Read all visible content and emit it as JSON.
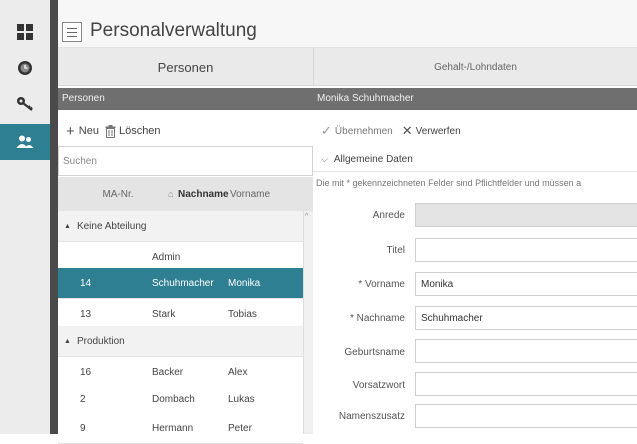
{
  "app": {
    "title": "Personalverwaltung"
  },
  "tabs": [
    {
      "label": "Personen"
    },
    {
      "label": "Gehalt-/Lohndaten"
    }
  ],
  "left_pane": {
    "header": "Personen",
    "toolbar": {
      "new_label": "Neu",
      "delete_label": "Löschen"
    },
    "search": {
      "placeholder": "Suchen"
    },
    "columns": [
      "MA-Nr.",
      "Nachname",
      "Vorname"
    ],
    "groups": [
      {
        "label": "Keine Abteilung",
        "rows": [
          {
            "id": "",
            "last": "Admin",
            "first": ""
          },
          {
            "id": "14",
            "last": "Schuhmacher",
            "first": "Monika"
          },
          {
            "id": "13",
            "last": "Stark",
            "first": "Tobias"
          }
        ]
      },
      {
        "label": "Produktion",
        "rows": [
          {
            "id": "16",
            "last": "Backer",
            "first": "Alex"
          },
          {
            "id": "2",
            "last": "Dombach",
            "first": "Lukas"
          },
          {
            "id": "9",
            "last": "Hermann",
            "first": "Peter"
          }
        ]
      }
    ],
    "selected_row": "14"
  },
  "right_pane": {
    "header": "Monika Schuhmacher",
    "toolbar": {
      "apply_label": "Übernehmen",
      "discard_label": "Verwerfen"
    },
    "section_title": "Allgemeine Daten",
    "hint": "Die mit * gekennzeichneten Felder sind Pflichtfelder und müssen a",
    "fields": [
      {
        "label": "Anrede",
        "value": ""
      },
      {
        "label": "Titel",
        "value": ""
      },
      {
        "label": "* Vorname",
        "value": "Monika"
      },
      {
        "label": "* Nachname",
        "value": "Schuhmacher"
      },
      {
        "label": "Geburtsname",
        "value": ""
      },
      {
        "label": "Vorsatzwort",
        "value": ""
      },
      {
        "label": "Namenszusatz",
        "value": ""
      }
    ]
  },
  "colors": {
    "accent": "#2f7f92",
    "section_bar": "#6f6f6f",
    "rail": "#ececec"
  },
  "icons": [
    "dashboard-icon",
    "clock-icon",
    "key-icon",
    "people-icon",
    "hamburger-icon",
    "plus-icon",
    "trash-icon",
    "check-icon",
    "x-icon",
    "chevron-down-icon",
    "sort-up-icon",
    "triangle-up-icon"
  ]
}
